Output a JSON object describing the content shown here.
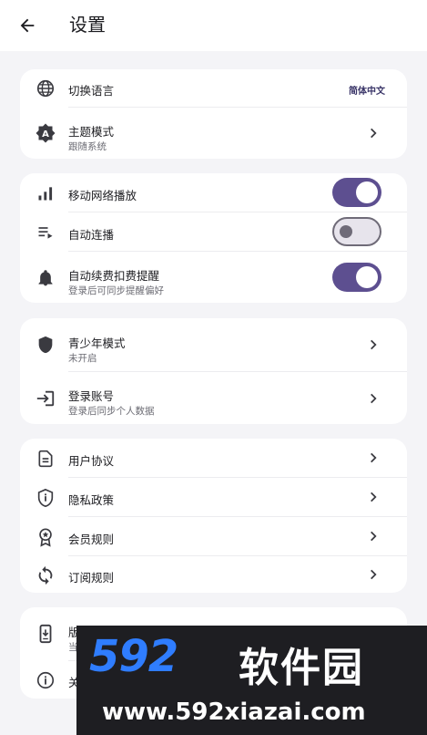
{
  "header": {
    "title": "设置"
  },
  "group1": {
    "language": {
      "title": "切换语言",
      "value": "简体中文"
    },
    "theme": {
      "title": "主题模式",
      "subtitle": "跟随系统"
    }
  },
  "group2": {
    "mobile_network": {
      "title": "移动网络播放",
      "state": "on"
    },
    "autoplay": {
      "title": "自动连播",
      "state": "off"
    },
    "renewal": {
      "title": "自动续费扣费提醒",
      "subtitle": "登录后可同步提醒偏好",
      "state": "on"
    }
  },
  "group3": {
    "youth": {
      "title": "青少年模式",
      "subtitle": "未开启"
    },
    "login": {
      "title": "登录账号",
      "subtitle": "登录后同步个人数据"
    }
  },
  "group4": {
    "user_agreement": {
      "title": "用户协议"
    },
    "privacy": {
      "title": "隐私政策"
    },
    "member_rules": {
      "title": "会员规则"
    },
    "subscription_rules": {
      "title": "订阅规则"
    }
  },
  "group5": {
    "version": {
      "title": "版本更新",
      "subtitle": "当"
    },
    "about": {
      "title": "关"
    }
  },
  "watermark": {
    "logo": "592",
    "cn": "软件园",
    "url": "www.592xiazai.com"
  },
  "colors": {
    "accent": "#5d4f90",
    "background": "#f4f4f7",
    "card": "#ffffff"
  }
}
